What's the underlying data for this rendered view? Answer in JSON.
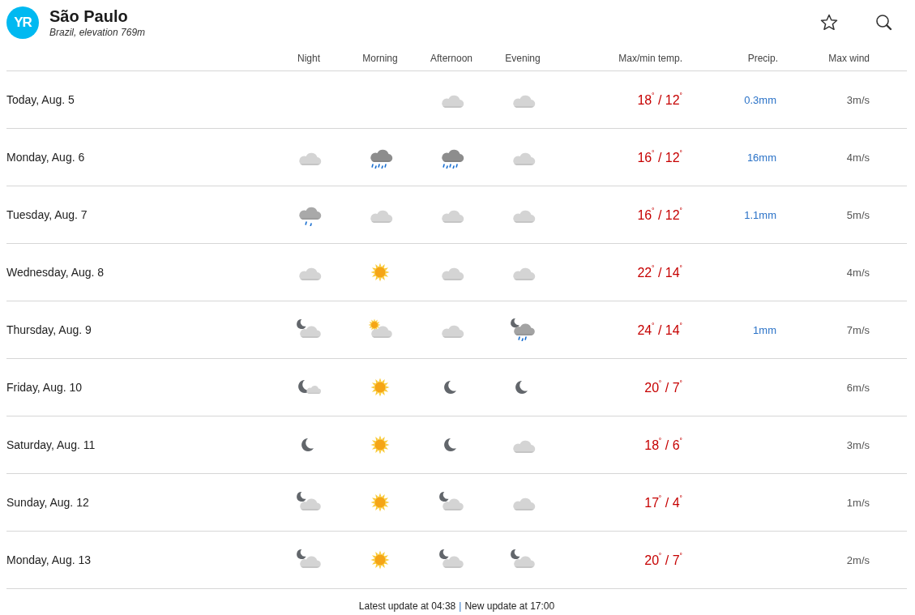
{
  "header": {
    "logo": "YR",
    "title": "São Paulo",
    "subtitle": "Brazil, elevation 769m"
  },
  "columns": {
    "periods": [
      "Night",
      "Morning",
      "Afternoon",
      "Evening"
    ],
    "temp": "Max/min temp.",
    "precip": "Precip.",
    "wind": "Max wind"
  },
  "days": [
    {
      "date": "Today, Aug. 5",
      "periods": [
        {
          "kind": "none"
        },
        {
          "kind": "none"
        },
        {
          "kind": "cloud"
        },
        {
          "kind": "cloud"
        }
      ],
      "temp": "18$^{˚}$ / 12$^{˚}$",
      "precip": "0.3mm",
      "wind": "3m/s"
    },
    {
      "date": "Monday, Aug. 6",
      "periods": [
        {
          "kind": "cloud"
        },
        {
          "kind": "rain"
        },
        {
          "kind": "rain"
        },
        {
          "kind": "cloud"
        }
      ],
      "temp": "16$^{˚}$ / 12$^{˚}$",
      "precip": "16mm",
      "wind": "4m/s"
    },
    {
      "date": "Tuesday, Aug. 7",
      "periods": [
        {
          "kind": "light-rain"
        },
        {
          "kind": "cloud"
        },
        {
          "kind": "cloud"
        },
        {
          "kind": "cloud"
        }
      ],
      "temp": "16$^{˚}$ / 12$^{˚}$",
      "precip": "1.1mm",
      "wind": "5m/s"
    },
    {
      "date": "Wednesday, Aug. 8",
      "periods": [
        {
          "kind": "cloud"
        },
        {
          "kind": "sun"
        },
        {
          "kind": "cloud"
        },
        {
          "kind": "cloud"
        }
      ],
      "temp": "22$^{˚}$ / 14$^{˚}$",
      "wind": "4m/s"
    },
    {
      "date": "Thursday, Aug. 9",
      "periods": [
        {
          "kind": "moon-cloud"
        },
        {
          "kind": "sun-cloud"
        },
        {
          "kind": "cloud"
        },
        {
          "kind": "moon-rain"
        }
      ],
      "temp": "24$^{˚}$ / 14$^{˚}$",
      "precip": "1mm",
      "wind": "7m/s"
    },
    {
      "date": "Friday, Aug. 10",
      "periods": [
        {
          "kind": "moon-small-cloud"
        },
        {
          "kind": "sun"
        },
        {
          "kind": "moon"
        },
        {
          "kind": "moon"
        }
      ],
      "temp": "20$^{˚}$ / 7$^{˚}$",
      "wind": "6m/s"
    },
    {
      "date": "Saturday, Aug. 11",
      "periods": [
        {
          "kind": "moon"
        },
        {
          "kind": "sun"
        },
        {
          "kind": "moon"
        },
        {
          "kind": "cloud"
        }
      ],
      "temp": "18$^{˚}$ / 6$^{˚}$",
      "wind": "3m/s"
    },
    {
      "date": "Sunday, Aug. 12",
      "periods": [
        {
          "kind": "moon-cloud"
        },
        {
          "kind": "sun"
        },
        {
          "kind": "moon-cloud"
        },
        {
          "kind": "cloud"
        }
      ],
      "temp": "17$^{˚}$ / 4$^{˚}$",
      "wind": "1m/s"
    },
    {
      "date": "Monday, Aug. 13",
      "periods": [
        {
          "kind": "moon-cloud"
        },
        {
          "kind": "sun"
        },
        {
          "kind": "moon-cloud"
        },
        {
          "kind": "moon-cloud"
        }
      ],
      "temp": "20$^{˚}$ / 7$^{˚}$",
      "wind": "2m/s"
    }
  ],
  "footer": {
    "latest": "Latest update at 04:38",
    "separator": "|",
    "next": "New update at 17:00"
  }
}
